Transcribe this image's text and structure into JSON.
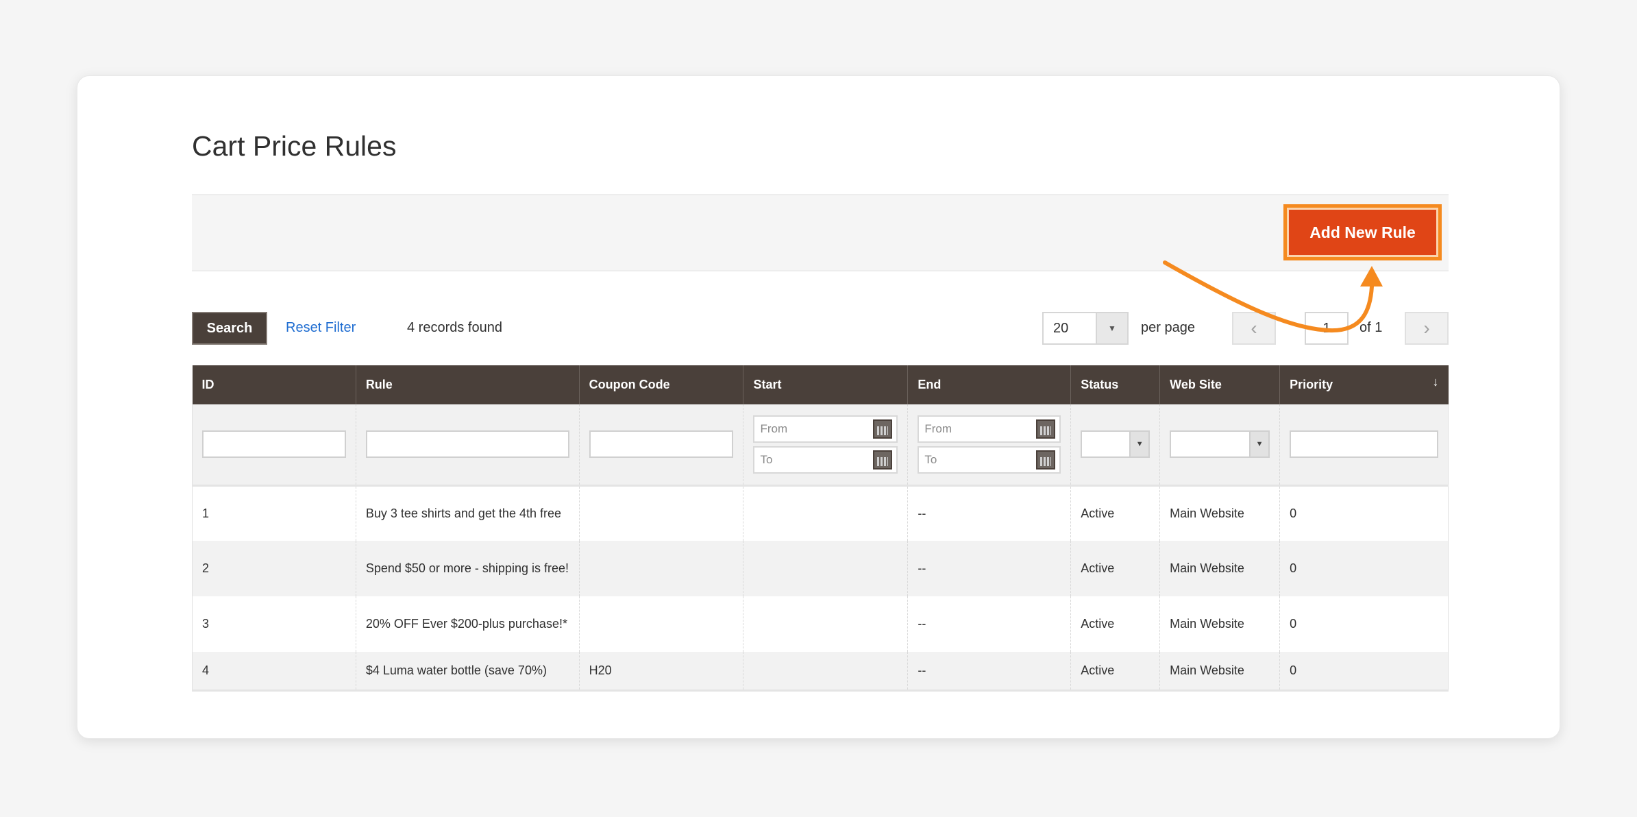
{
  "page": {
    "title": "Cart Price Rules"
  },
  "actions": {
    "add_new_rule_label": "Add New Rule",
    "highlight_color": "#f58a1f",
    "button_color": "#e04516"
  },
  "toolbar": {
    "search_label": "Search",
    "reset_filter_label": "Reset Filter",
    "records_found": "4 records found",
    "per_page_value": "20",
    "per_page_label": "per page",
    "current_page": "1",
    "page_of": "of 1",
    "prev_icon": "‹",
    "next_icon": "›"
  },
  "grid": {
    "columns": [
      {
        "label": "ID"
      },
      {
        "label": "Rule"
      },
      {
        "label": "Coupon Code"
      },
      {
        "label": "Start"
      },
      {
        "label": "End"
      },
      {
        "label": "Status"
      },
      {
        "label": "Web Site"
      },
      {
        "label": "Priority"
      }
    ],
    "sort_icon": "↓",
    "filters": {
      "from_placeholder": "From",
      "to_placeholder": "To"
    },
    "rows": [
      {
        "id": "1",
        "rule": "Buy 3 tee shirts and get the 4th free",
        "coupon": "",
        "start": "",
        "end": "--",
        "status": "Active",
        "website": "Main Website",
        "priority": "0"
      },
      {
        "id": "2",
        "rule": "Spend $50 or more - shipping is free!",
        "coupon": "",
        "start": "",
        "end": "--",
        "status": "Active",
        "website": "Main Website",
        "priority": "0"
      },
      {
        "id": "3",
        "rule": "20% OFF Ever $200-plus purchase!*",
        "coupon": "",
        "start": "",
        "end": "--",
        "status": "Active",
        "website": "Main Website",
        "priority": "0"
      },
      {
        "id": "4",
        "rule": "$4 Luma water bottle (save 70%)",
        "coupon": "H20",
        "start": "",
        "end": "--",
        "status": "Active",
        "website": "Main Website",
        "priority": "0"
      }
    ]
  }
}
